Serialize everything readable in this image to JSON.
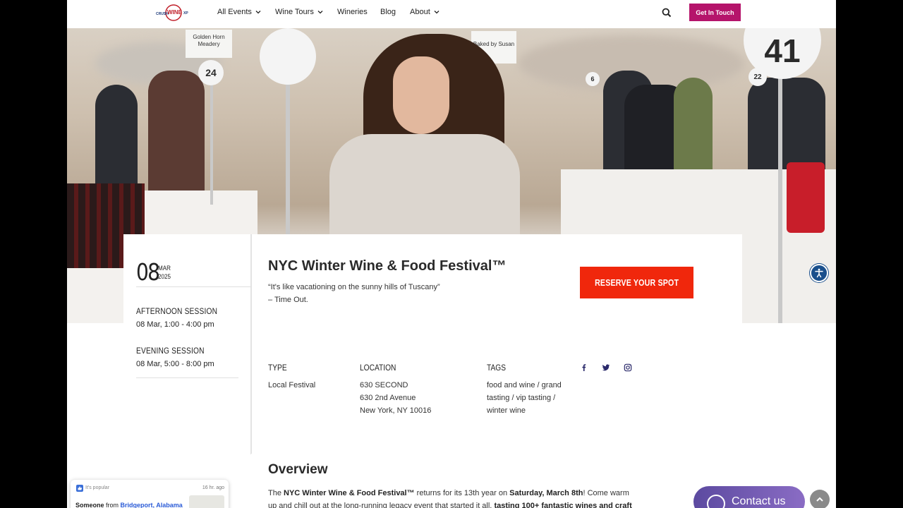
{
  "nav": {
    "logo_text": "CRUSH WINE XP",
    "items": [
      {
        "label": "All Events",
        "has_dropdown": true
      },
      {
        "label": "Wine Tours",
        "has_dropdown": true
      },
      {
        "label": "Wineries",
        "has_dropdown": false
      },
      {
        "label": "Blog",
        "has_dropdown": false
      },
      {
        "label": "About",
        "has_dropdown": true
      }
    ],
    "search_icon": "search-icon",
    "cta_label": "Get In Touch",
    "cta_color": "#b5146b"
  },
  "hero": {
    "sign_numbers": [
      "41",
      "24",
      "22",
      "6"
    ],
    "sign_texts": [
      "Golden Horn Meadery",
      "Baked by Susan"
    ]
  },
  "event": {
    "day": "08",
    "month": "MAR",
    "year": "2025",
    "sessions": [
      {
        "title": "AFTERNOON SESSION",
        "time": "08 Mar, 1:00 - 4:00 pm"
      },
      {
        "title": "EVENING SESSION",
        "time": "08 Mar, 5:00 - 8:00 pm"
      }
    ],
    "title": "NYC Winter Wine & Food Festival™",
    "quote_line1": "“It's like vacationing on the sunny hills of Tuscany”",
    "quote_line2": "– Time Out.",
    "reserve_label": "RESERVE YOUR SPOT",
    "reserve_color": "#f0270c",
    "type_heading": "TYPE",
    "type_value": "Local Festival",
    "location_heading": "LOCATION",
    "location_lines": [
      "630 SECOND",
      "630 2nd Avenue",
      "New York, NY 10016"
    ],
    "tags_heading": "TAGS",
    "tags_lines": [
      "food and wine / grand",
      "tasting / vip tasting /",
      "winter wine"
    ],
    "social": [
      "facebook-icon",
      "twitter-icon",
      "instagram-icon"
    ]
  },
  "overview": {
    "heading": "Overview",
    "p1_a": "The ",
    "p1_b": "NYC Winter Wine & Food Festival™",
    "p1_c": " returns for its 13th year on ",
    "p1_d": "Saturday, March 8th",
    "p1_e": "! Come warm",
    "p2_a": "up and chill out at the long-running legacy event that started it all, ",
    "p2_b": "tasting 100+ fantastic wines and craft"
  },
  "popup": {
    "tag": "It's popular",
    "ago": "16 hr. ago",
    "text_a": "Someone",
    "text_b": " from ",
    "text_c": "Bridgeport, Alabama"
  },
  "contact_label": "Contact us",
  "accessibility_icon": "accessibility-icon",
  "scroll_top_icon": "chevron-up-icon"
}
